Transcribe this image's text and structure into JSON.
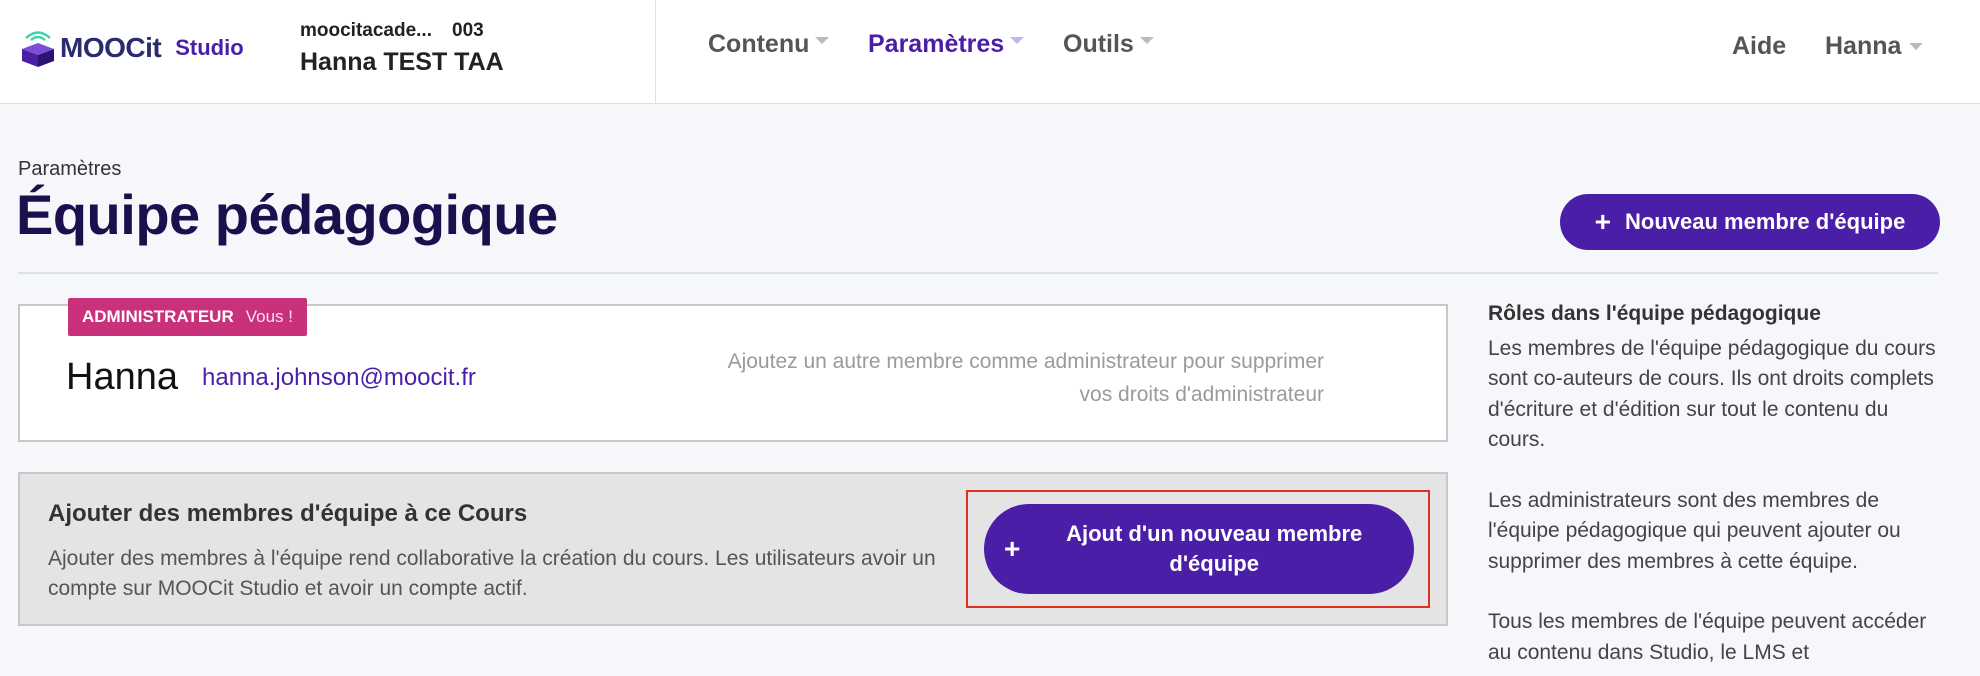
{
  "header": {
    "logo_text": "MOOCit",
    "logo_studio": "Studio",
    "course_org": "moocitacade...",
    "course_number": "003",
    "course_name": "Hanna TEST TAA",
    "nav": [
      {
        "label": "Contenu"
      },
      {
        "label": "Paramètres"
      },
      {
        "label": "Outils"
      }
    ],
    "help": "Aide",
    "user": "Hanna"
  },
  "page": {
    "label": "Paramètres",
    "title": "Équipe pédagogique",
    "new_member_button": "Nouveau membre d'équipe"
  },
  "member": {
    "role": "ADMINISTRATEUR",
    "you": "Vous !",
    "name": "Hanna",
    "email": "hanna.johnson@moocit.fr",
    "hint": "Ajoutez un autre membre comme administrateur pour supprimer vos droits d'administrateur"
  },
  "add_panel": {
    "title": "Ajouter des membres d'équipe à ce Cours",
    "text": "Ajouter des membres à l'équipe rend collaborative la création du cours. Les utilisateurs avoir un compte sur MOOCit Studio et avoir un compte actif.",
    "button": "Ajout d'un nouveau membre d'équipe"
  },
  "sidebar": {
    "title": "Rôles dans l'équipe pédagogique",
    "paragraphs": [
      "Les membres de l'équipe pédagogique du cours sont co-auteurs de cours. Ils ont droits complets d'écriture et d'édition sur tout le contenu du cours.",
      "Les administrateurs sont des membres de l'équipe pédagogique qui peuvent ajouter ou supprimer des membres à cette équipe.",
      "Tous les membres de l'équipe peuvent accéder au contenu dans Studio, le LMS et"
    ]
  },
  "colors": {
    "brand": "#4b1ea8",
    "title": "#1d0f4d",
    "badge": "#c9317a",
    "highlight": "#e0301e"
  },
  "icons": {
    "logo": "cube-logo-icon",
    "plus": "plus-icon",
    "caret": "chevron-down-icon"
  }
}
